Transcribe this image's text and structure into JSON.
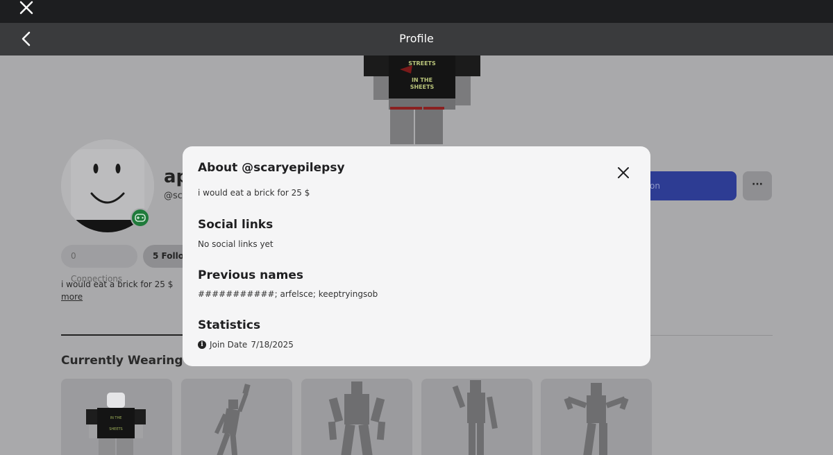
{
  "header": {
    "title": "Profile"
  },
  "profile": {
    "display_name": "ap",
    "username": "@sc",
    "primary_action_label": "tion",
    "more_label": "···",
    "connections_label": "0 Connections",
    "followers_label": "5 Follo",
    "bio": "i would eat a brick for 25 $",
    "more_link": "more",
    "section_currently_wearing": "Currently Wearing"
  },
  "modal": {
    "about_title": "About @scaryepilepsy",
    "about_text": "i would eat a brick for 25 $",
    "social_title": "Social links",
    "social_text": "No social links yet",
    "previous_title": "Previous names",
    "previous_text": "###########; arfelsce; keeptryingsob",
    "stats_title": "Statistics",
    "join_label": "Join Date",
    "join_date": "7/18/2025",
    "info_icon_glyph": "i"
  },
  "icons": {
    "close": "close-icon",
    "back": "chevron-left-icon",
    "modal_close": "close-icon",
    "info": "info-icon"
  },
  "colors": {
    "modal_bg": "#f5f5f6",
    "primary_button": "#2d3c93",
    "online_badge": "#1f7a3a"
  }
}
